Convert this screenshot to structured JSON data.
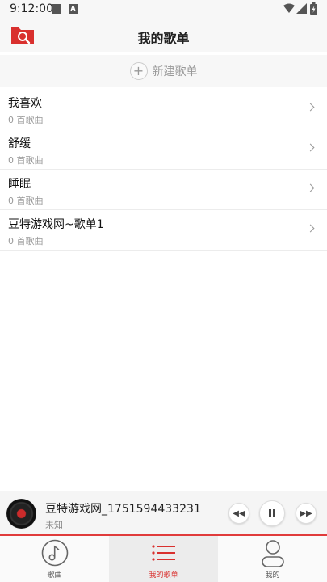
{
  "status_bar": {
    "time": "9:12:00",
    "icons": [
      "notification-square-icon",
      "a-badge-icon",
      "wifi-icon",
      "signal-icon",
      "battery-icon"
    ],
    "a_badge": "A"
  },
  "header": {
    "title": "我的歌单",
    "search_icon": "search-icon",
    "accent_color": "#d9302e"
  },
  "new_playlist": {
    "icon": "plus-icon",
    "label": "新建歌单"
  },
  "playlists": [
    {
      "name": "我喜欢",
      "count": "0 首歌曲"
    },
    {
      "name": "舒缓",
      "count": "0 首歌曲"
    },
    {
      "name": "睡眠",
      "count": "0 首歌曲"
    },
    {
      "name": "豆特游戏网~歌单1",
      "count": "0 首歌曲"
    }
  ],
  "player": {
    "title": "豆特游戏网_1751594433231",
    "artist": "未知",
    "icons": [
      "vinyl-disc-icon",
      "rewind-icon",
      "pause-icon",
      "fast-forward-icon"
    ],
    "progress_color": "#e03b3b"
  },
  "bottom_nav": {
    "items": [
      {
        "label": "歌曲",
        "icon": "music-note-icon"
      },
      {
        "label": "我的歌单",
        "icon": "list-icon"
      },
      {
        "label": "我的",
        "icon": "person-icon"
      }
    ],
    "active_index": 1,
    "active_color": "#d9302e"
  }
}
